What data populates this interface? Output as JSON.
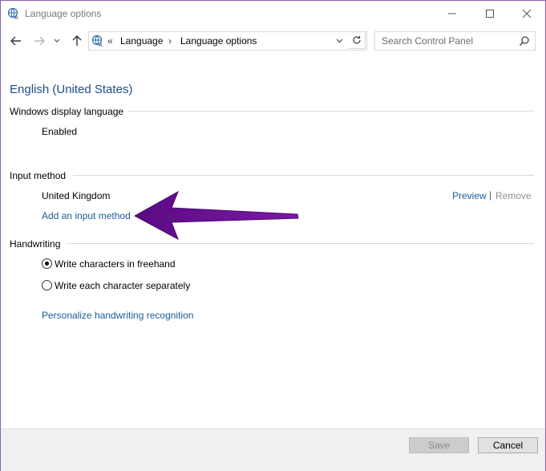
{
  "window": {
    "title": "Language options",
    "controls": {
      "minimize": "—",
      "maximize": "☐",
      "close": "✕"
    }
  },
  "addressbar": {
    "chevrons": "«",
    "breadcrumbs": [
      "Language",
      "Language options"
    ],
    "separator": "›",
    "dropdown_icon": "chevron-down-icon",
    "refresh_icon": "refresh-icon",
    "search_placeholder": "Search Control Panel"
  },
  "main": {
    "language": "English (United States)",
    "display_language": {
      "label": "Windows display language",
      "status": "Enabled"
    },
    "input_method": {
      "label": "Input method",
      "method": "United Kingdom",
      "preview_label": "Preview",
      "separator": "|",
      "remove_label": "Remove",
      "add_label": "Add an input method"
    },
    "handwriting": {
      "label": "Handwriting",
      "options": [
        {
          "label": "Write characters in freehand",
          "selected": true
        },
        {
          "label": "Write each character separately",
          "selected": false
        }
      ],
      "personalize_label": "Personalize handwriting recognition"
    }
  },
  "annotation": {
    "arrow_color": "#6a0d91"
  },
  "footer": {
    "save_label": "Save",
    "cancel_label": "Cancel"
  },
  "colors": {
    "link": "#1c5d99",
    "heading": "#1c4e8c",
    "window_border": "#8b5fa8"
  }
}
